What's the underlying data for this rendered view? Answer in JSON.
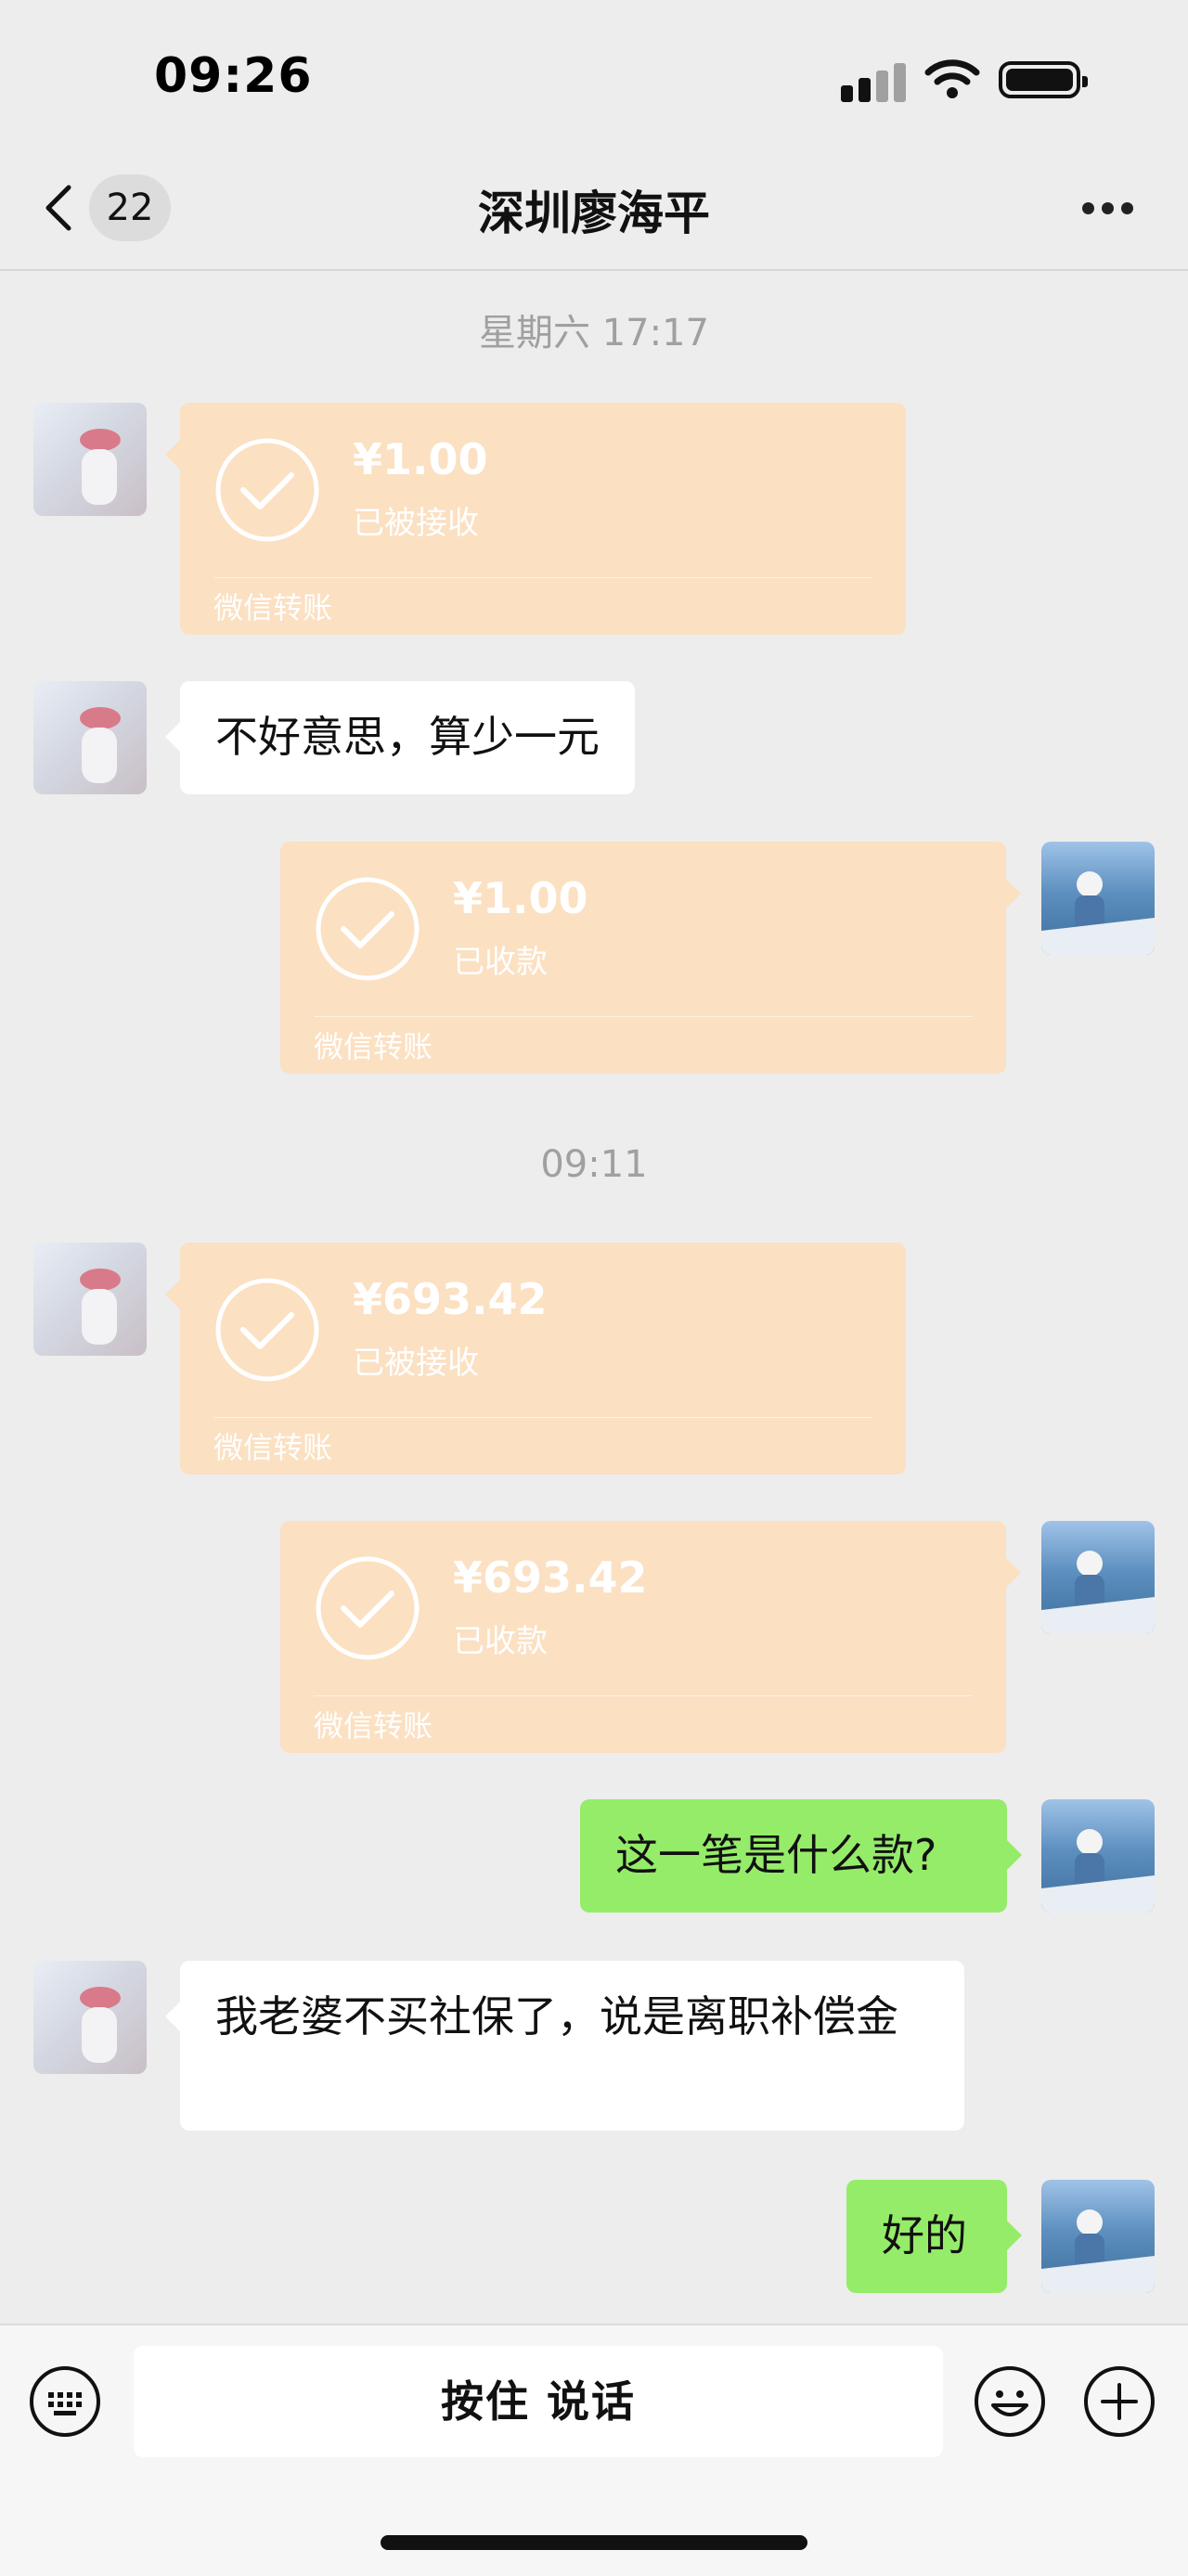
{
  "status_bar": {
    "time": "09:26"
  },
  "nav": {
    "back_badge": "22",
    "title": "深圳廖海平"
  },
  "messages": [
    {
      "type": "timestamp",
      "text": "星期六 17:17"
    },
    {
      "type": "transfer",
      "side": "left",
      "amount": "¥1.00",
      "status": "已被接收",
      "footer": "微信转账"
    },
    {
      "type": "text",
      "side": "left",
      "text": "不好意思，算少一元"
    },
    {
      "type": "transfer",
      "side": "right",
      "amount": "¥1.00",
      "status": "已收款",
      "footer": "微信转账"
    },
    {
      "type": "timestamp",
      "text": "09:11"
    },
    {
      "type": "transfer",
      "side": "left",
      "amount": "¥693.42",
      "status": "已被接收",
      "footer": "微信转账"
    },
    {
      "type": "transfer",
      "side": "right",
      "amount": "¥693.42",
      "status": "已收款",
      "footer": "微信转账"
    },
    {
      "type": "text",
      "side": "right",
      "text": "这一笔是什么款?"
    },
    {
      "type": "text",
      "side": "left",
      "text": "我老婆不买社保了，说是离职补偿金"
    },
    {
      "type": "text",
      "side": "right",
      "text": "好的"
    }
  ],
  "input_bar": {
    "hold_to_talk": "按住 说话"
  },
  "colors": {
    "background": "#ededed",
    "transfer_card": "#fbe0c2",
    "sent_bubble": "#95ec69",
    "received_bubble": "#ffffff"
  }
}
